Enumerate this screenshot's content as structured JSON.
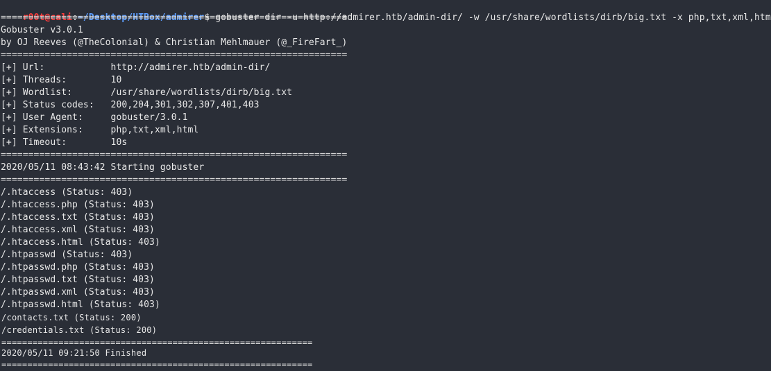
{
  "theme": {
    "background": "#2a2e37",
    "foreground": "#e8e8e8",
    "prompt_user_color": "#ff3b3b",
    "prompt_path_color": "#5b9dff"
  },
  "prompt": {
    "user": "r00t@cali",
    "colon": ":",
    "path": "~/Desktop/HTBox/admirer",
    "symbol": "$",
    "command": " gobuster dir -u http://admirer.htb/admin-dir/ -w /usr/share/wordlists/dirb/big.txt -x php,txt,xml,html"
  },
  "output": {
    "separator": "===============================================================",
    "separator_short": "============================================================",
    "banner": [
      "Gobuster v3.0.1",
      "by OJ Reeves (@TheColonial) & Christian Mehlmauer (@_FireFart_)"
    ],
    "config": [
      "[+] Url:            http://admirer.htb/admin-dir/",
      "[+] Threads:        10",
      "[+] Wordlist:       /usr/share/wordlists/dirb/big.txt",
      "[+] Status codes:   200,204,301,302,307,401,403",
      "[+] User Agent:     gobuster/3.0.1",
      "[+] Extensions:     php,txt,xml,html",
      "[+] Timeout:        10s"
    ],
    "start": "2020/05/11 08:43:42 Starting gobuster",
    "results": [
      "/.htaccess (Status: 403)",
      "/.htaccess.php (Status: 403)",
      "/.htaccess.txt (Status: 403)",
      "/.htaccess.xml (Status: 403)",
      "/.htaccess.html (Status: 403)",
      "/.htpasswd (Status: 403)",
      "/.htpasswd.php (Status: 403)",
      "/.htpasswd.txt (Status: 403)",
      "/.htpasswd.xml (Status: 403)",
      "/.htpasswd.html (Status: 403)"
    ],
    "results_found": [
      "/contacts.txt (Status: 200)",
      "/credentials.txt (Status: 200)"
    ],
    "finish": "2020/05/11 09:21:50 Finished"
  }
}
